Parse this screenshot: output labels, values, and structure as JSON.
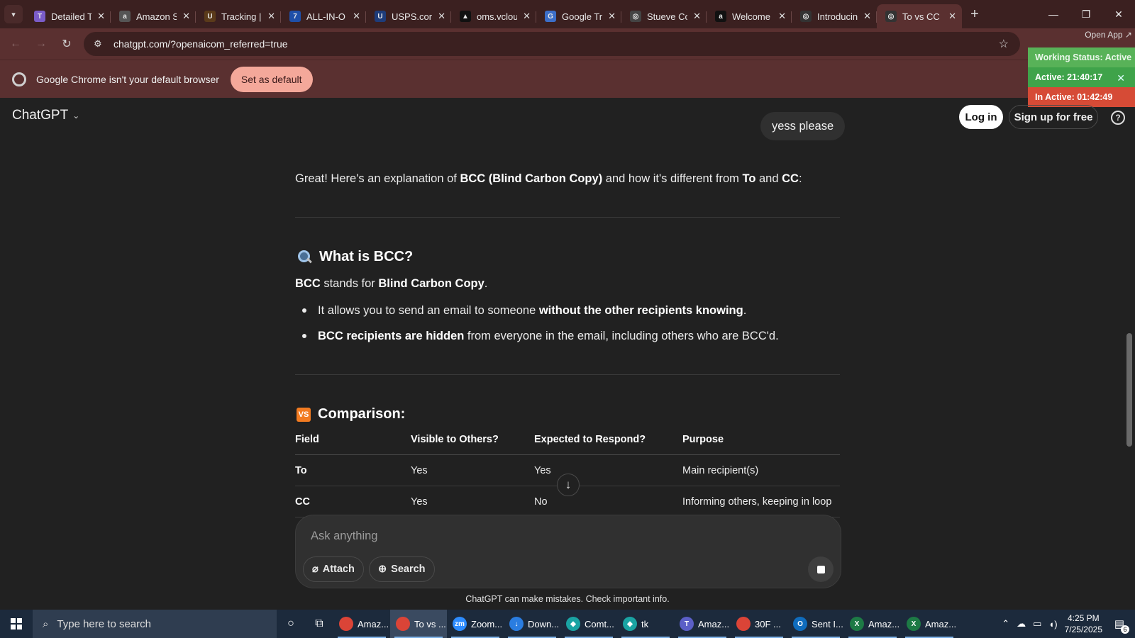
{
  "browser": {
    "tabs": [
      {
        "title": "Detailed T",
        "fav": "T",
        "fav_color": "#7a5cc8"
      },
      {
        "title": "Amazon S",
        "fav": "a",
        "fav_color": "#555555"
      },
      {
        "title": "Tracking |",
        "fav": "U",
        "fav_color": "#5a3a1a"
      },
      {
        "title": "ALL-IN-O",
        "fav": "7",
        "fav_color": "#1f4fa8"
      },
      {
        "title": "USPS.com",
        "fav": "U",
        "fav_color": "#1e3c7a"
      },
      {
        "title": "oms.vclou",
        "fav": "▲",
        "fav_color": "#111111"
      },
      {
        "title": "Google Tr",
        "fav": "G",
        "fav_color": "#3c6ec8"
      },
      {
        "title": "Stueve Co",
        "fav": "◎",
        "fav_color": "#444444"
      },
      {
        "title": "Welcome",
        "fav": "a",
        "fav_color": "#111111"
      },
      {
        "title": "Introducin",
        "fav": "◎",
        "fav_color": "#333333"
      },
      {
        "title": "To vs CC",
        "fav": "◎",
        "fav_color": "#333333",
        "active": true
      }
    ],
    "url": "chatgpt.com/?openaicom_referred=true",
    "infobar_message": "Google Chrome isn't your default browser",
    "infobar_button": "Set as default"
  },
  "status_widget": {
    "open_app": "Open App ↗",
    "working": "Working Status: Active",
    "active": "Active: 21:40:17",
    "inactive": "In Active: 01:42:49"
  },
  "header": {
    "title": "ChatGPT",
    "login": "Log in",
    "signup": "Sign up for free"
  },
  "conversation": {
    "user_message": "yess please",
    "intro": {
      "t1": "Great! Here's an explanation of ",
      "b1": "BCC (Blind Carbon Copy)",
      "t2": " and how it's different from ",
      "b2": "To",
      "t3": " and ",
      "b3": "CC",
      "t4": ":"
    },
    "section1": {
      "heading": "What is BCC?",
      "p_b1": "BCC",
      "p_t1": " stands for ",
      "p_b2": "Blind Carbon Copy",
      "p_t2": ".",
      "bullet1_t": "It allows you to send an email to someone ",
      "bullet1_b": "without the other recipients knowing",
      "bullet1_end": ".",
      "bullet2_b": "BCC recipients are hidden",
      "bullet2_t": " from everyone in the email, including others who are BCC'd."
    },
    "section2": {
      "badge": "VS",
      "heading": "Comparison:",
      "columns": [
        "Field",
        "Visible to Others?",
        "Expected to Respond?",
        "Purpose"
      ],
      "rows": [
        [
          "To",
          "Yes",
          "Yes",
          "Main recipient(s)"
        ],
        [
          "CC",
          "Yes",
          "No",
          "Informing others, keeping in loop"
        ]
      ]
    }
  },
  "composer": {
    "placeholder": "Ask anything",
    "attach": "Attach",
    "search": "Search",
    "disclaimer": "ChatGPT can make mistakes. Check important info."
  },
  "taskbar": {
    "search_placeholder": "Type here to search",
    "apps": [
      {
        "label": "Amaz...",
        "icon": "chrome-icon",
        "color": "#db4437",
        "badge": "1"
      },
      {
        "label": "To vs ...",
        "icon": "chrome-icon",
        "color": "#db4437",
        "selected": true
      },
      {
        "label": "Zoom...",
        "icon": "zoom-icon",
        "color": "#2d8cff",
        "glyph": "zm"
      },
      {
        "label": "Down...",
        "icon": "download-icon",
        "color": "#2a7de1",
        "glyph": "↓"
      },
      {
        "label": "Comt...",
        "icon": "app-icon",
        "color": "#1aa3a3",
        "glyph": "◆"
      },
      {
        "label": "tk",
        "icon": "app-icon",
        "color": "#1aa3a3",
        "glyph": "◆"
      },
      {
        "label": "Amaz...",
        "icon": "teams-icon",
        "color": "#5b5fc7",
        "glyph": "T",
        "badge": "1"
      },
      {
        "label": "30F ...",
        "icon": "chrome-icon",
        "color": "#db4437"
      },
      {
        "label": "Sent I...",
        "icon": "outlook-icon",
        "color": "#0f6cbd",
        "glyph": "O"
      },
      {
        "label": "Amaz...",
        "icon": "excel-icon",
        "color": "#1d7a45",
        "glyph": "X"
      },
      {
        "label": "Amaz...",
        "icon": "excel-icon",
        "color": "#1d7a45",
        "glyph": "X"
      }
    ],
    "time": "4:25 PM",
    "date": "7/25/2025",
    "notifications": "6"
  }
}
